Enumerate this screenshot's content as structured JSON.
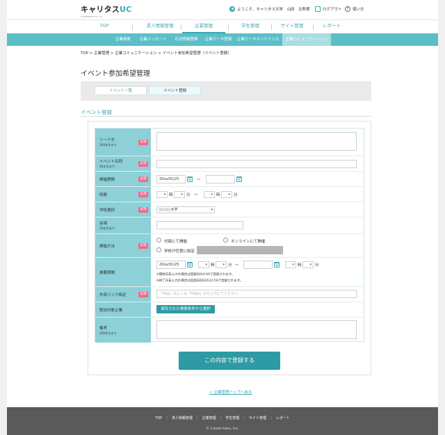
{
  "header": {
    "logo_main": "キャリタス",
    "logo_uc": "UC",
    "logo_sub": "CAREERTASU UC",
    "welcome": "ようこそ、キャリタス大学　山田　太郎様",
    "logout": "ログアウト",
    "help": "使い方",
    "help_glyph": "?"
  },
  "mainnav": {
    "items": [
      "TOP",
      "求人情報管理",
      "企業管理",
      "学生管理",
      "サイト管理",
      "レポート"
    ],
    "active_index": 2
  },
  "subnav": {
    "items": [
      "企業検索",
      "企業メッセージ",
      "応対情報登録",
      "企業データ登録",
      "企業データメンテナンス",
      "企業コミュニケーション"
    ],
    "active_index": 5
  },
  "breadcrumb": "TOP > 企業管理 > 企業コミュニケーション > イベント参加希望管理（イベント登録）",
  "page_title": "イベント参加希望管理",
  "tabs": [
    "イベント一覧",
    "イベント登録"
  ],
  "section_title": "イベント登録",
  "form": {
    "required_label": "必須",
    "lead": {
      "label": "リード文",
      "sub": "200文字まで"
    },
    "name": {
      "label": "イベント名称",
      "sub": "50文字まで"
    },
    "period": {
      "label": "開催期間",
      "from": "20xx/01/25",
      "tilde": "〜"
    },
    "time": {
      "label": "時間",
      "hour": "時",
      "minute": "分",
      "tilde": "〜"
    },
    "school": {
      "label": "学校選択",
      "value": "○○○○大学"
    },
    "venue": {
      "label": "会場",
      "sub": "20文字まで"
    },
    "method": {
      "label": "開催方法",
      "opt1": "対面にて開催",
      "opt2": "オンラインにて開催",
      "opt3": "学校が任意に設定"
    },
    "publish": {
      "label": "掲載期間",
      "from": "20xx/01/25",
      "hour": "時",
      "minute": "分",
      "tilde": "〜",
      "note1": "※開始日未入力の場合は登録日の0:00で登録されます。",
      "note2": "※終了日未入力の場合は実施日前日の23:59で登録されます。"
    },
    "link": {
      "label": "外部リンク設定",
      "placeholder": "「http」もしくは「https」から入力してください。"
    },
    "target": {
      "label": "配信対象企業",
      "button": "保存された検索条件から選択"
    },
    "remarks": {
      "label": "備考",
      "sub": "200文字まで"
    }
  },
  "submit_label": "この内容で登録する",
  "back_link": "< 企業管理トップへ戻る",
  "footer": {
    "items": [
      "TOP",
      "求人情報管理",
      "企業管理",
      "学生管理",
      "サイト管理",
      "レポート"
    ],
    "sep": "|",
    "copyright": "© Career-tasu, Inc."
  },
  "colors": {
    "accent": "#3aa8b3",
    "subnav": "#5bbfc7",
    "label_bg": "#8dd0d7",
    "required": "#f06b8a",
    "footer": "#5a5a5a"
  }
}
